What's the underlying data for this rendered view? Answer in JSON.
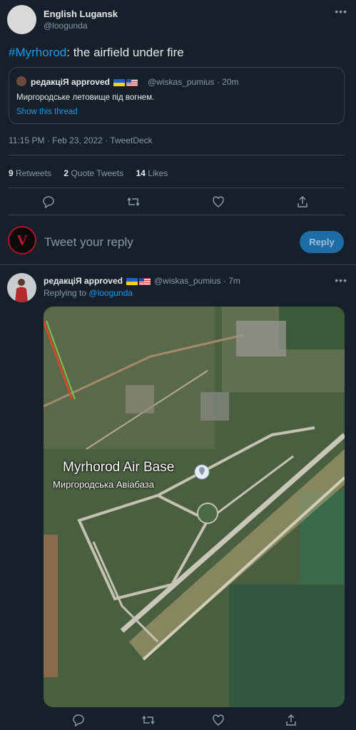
{
  "main_tweet": {
    "display_name": "English Lugansk",
    "handle": "@loogunda",
    "hashtag": "#Myrhorod",
    "text_rest": ": the airfield under fire",
    "quote": {
      "display_name": "редакціЯ approved",
      "handle_time": "@wiskas_pumius · 20m",
      "text": "Миргородське летовище під вогнем.",
      "show_thread": "Show this thread"
    },
    "timestamp": "11:15 PM · Feb 23, 2022 · TweetDeck",
    "stats": {
      "retweets_count": "9",
      "retweets_label": "Retweets",
      "quotes_count": "2",
      "quotes_label": "Quote Tweets",
      "likes_count": "14",
      "likes_label": "Likes"
    }
  },
  "composer": {
    "placeholder": "Tweet your reply",
    "reply_button": "Reply"
  },
  "reply_tweet": {
    "display_name": "редакціЯ approved",
    "handle_time": "@wiskas_pumius · 7m",
    "replying_prefix": "Replying to",
    "replying_handle": "@loogunda",
    "map_label_en": "Myrhorod Air Base",
    "map_label_ua": "Миргородська Авіабаза"
  },
  "icons": [
    "more-icon",
    "reply-icon",
    "retweet-icon",
    "like-icon",
    "share-icon",
    "location-pin-icon"
  ],
  "colors": {
    "background": "#15202b",
    "accent": "#1d9bf0",
    "border": "#38444d"
  }
}
